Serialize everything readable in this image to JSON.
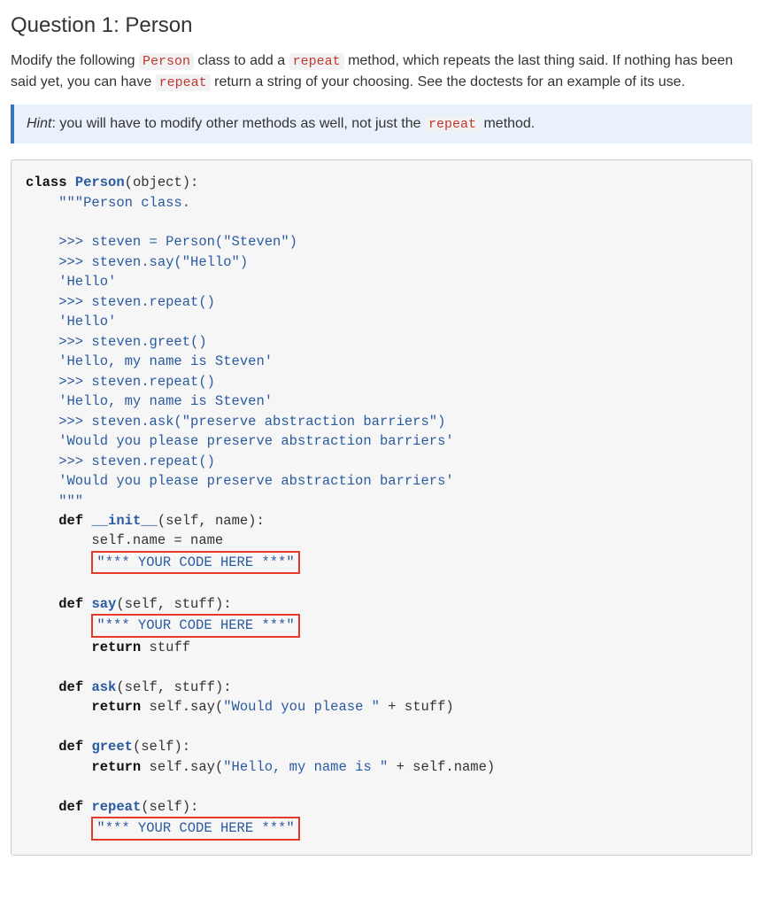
{
  "heading": "Question 1: Person",
  "intro_pre": "Modify the following ",
  "intro_code1": "Person",
  "intro_mid1": " class to add a ",
  "intro_code2": "repeat",
  "intro_mid2": " method, which repeats the last thing said. If nothing has been said yet, you can have ",
  "intro_code3": "repeat",
  "intro_post": " return a string of your choosing. See the doctests for an example of its use.",
  "hint_label": "Hint",
  "hint_pre": ": you will have to modify other methods as well, not just the ",
  "hint_code": "repeat",
  "hint_post": " method.",
  "code": {
    "l1_kw": "class",
    "l1_cls": "Person",
    "l1_rest": "(object):",
    "l2": "    \"\"\"Person class.",
    "l3": "",
    "l4": "    >>> steven = Person(\"Steven\")",
    "l5": "    >>> steven.say(\"Hello\")",
    "l6": "    'Hello'",
    "l7": "    >>> steven.repeat()",
    "l8": "    'Hello'",
    "l9": "    >>> steven.greet()",
    "l10": "    'Hello, my name is Steven'",
    "l11": "    >>> steven.repeat()",
    "l12": "    'Hello, my name is Steven'",
    "l13": "    >>> steven.ask(\"preserve abstraction barriers\")",
    "l14": "    'Would you please preserve abstraction barriers'",
    "l15": "    >>> steven.repeat()",
    "l16": "    'Would you please preserve abstraction barriers'",
    "l17": "    \"\"\"",
    "def": "def",
    "ret": "return",
    "init": "__init__",
    "init_args": "(self, name):",
    "init_body": "        self.name = name",
    "placeholder": "\"*** YOUR CODE HERE ***\"",
    "say": "say",
    "say_args": "(self, stuff):",
    "say_ret": " stuff",
    "ask": "ask",
    "ask_args": "(self, stuff):",
    "ask_ret_pre": " self.say(",
    "ask_str": "\"Would you please \"",
    "ask_ret_post": " + stuff)",
    "greet": "greet",
    "greet_args": "(self):",
    "greet_ret_pre": " self.say(",
    "greet_str": "\"Hello, my name is \"",
    "greet_ret_post": " + self.name)",
    "repeat": "repeat",
    "repeat_args": "(self):",
    "indent8": "        "
  }
}
